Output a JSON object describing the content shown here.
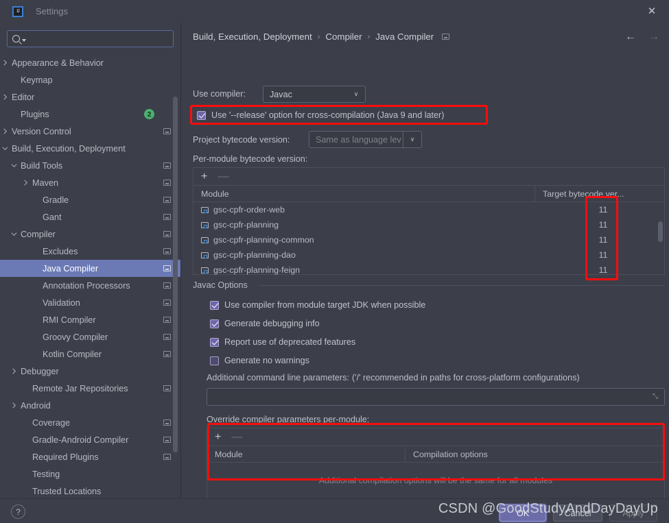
{
  "window": {
    "title": "Settings",
    "logo_text": "IJ",
    "close_label": "✕"
  },
  "search": {
    "value": "",
    "placeholder": ""
  },
  "sidebar": {
    "items": [
      {
        "label": "Appearance & Behavior",
        "indent": 0,
        "chevron": "right",
        "restore": false,
        "badge": null,
        "selected": false
      },
      {
        "label": "Keymap",
        "indent": 1,
        "chevron": "none",
        "restore": false,
        "badge": null,
        "selected": false
      },
      {
        "label": "Editor",
        "indent": 0,
        "chevron": "right",
        "restore": false,
        "badge": null,
        "selected": false
      },
      {
        "label": "Plugins",
        "indent": 1,
        "chevron": "none",
        "restore": false,
        "badge": "2",
        "selected": false
      },
      {
        "label": "Version Control",
        "indent": 0,
        "chevron": "right",
        "restore": true,
        "badge": null,
        "selected": false
      },
      {
        "label": "Build, Execution, Deployment",
        "indent": 0,
        "chevron": "down",
        "restore": false,
        "badge": null,
        "selected": false
      },
      {
        "label": "Build Tools",
        "indent": 1,
        "chevron": "down",
        "restore": true,
        "badge": null,
        "selected": false
      },
      {
        "label": "Maven",
        "indent": 2,
        "chevron": "right",
        "restore": true,
        "badge": null,
        "selected": false
      },
      {
        "label": "Gradle",
        "indent": 3,
        "chevron": "none",
        "restore": true,
        "badge": null,
        "selected": false
      },
      {
        "label": "Gant",
        "indent": 3,
        "chevron": "none",
        "restore": true,
        "badge": null,
        "selected": false
      },
      {
        "label": "Compiler",
        "indent": 1,
        "chevron": "down",
        "restore": true,
        "badge": null,
        "selected": false
      },
      {
        "label": "Excludes",
        "indent": 3,
        "chevron": "none",
        "restore": true,
        "badge": null,
        "selected": false
      },
      {
        "label": "Java Compiler",
        "indent": 3,
        "chevron": "none",
        "restore": true,
        "badge": null,
        "selected": true
      },
      {
        "label": "Annotation Processors",
        "indent": 3,
        "chevron": "none",
        "restore": true,
        "badge": null,
        "selected": false
      },
      {
        "label": "Validation",
        "indent": 3,
        "chevron": "none",
        "restore": true,
        "badge": null,
        "selected": false
      },
      {
        "label": "RMI Compiler",
        "indent": 3,
        "chevron": "none",
        "restore": true,
        "badge": null,
        "selected": false
      },
      {
        "label": "Groovy Compiler",
        "indent": 3,
        "chevron": "none",
        "restore": true,
        "badge": null,
        "selected": false
      },
      {
        "label": "Kotlin Compiler",
        "indent": 3,
        "chevron": "none",
        "restore": true,
        "badge": null,
        "selected": false
      },
      {
        "label": "Debugger",
        "indent": 1,
        "chevron": "right",
        "restore": false,
        "badge": null,
        "selected": false
      },
      {
        "label": "Remote Jar Repositories",
        "indent": 2,
        "chevron": "none",
        "restore": true,
        "badge": null,
        "selected": false
      },
      {
        "label": "Android",
        "indent": 1,
        "chevron": "right",
        "restore": false,
        "badge": null,
        "selected": false
      },
      {
        "label": "Coverage",
        "indent": 2,
        "chevron": "none",
        "restore": true,
        "badge": null,
        "selected": false
      },
      {
        "label": "Gradle-Android Compiler",
        "indent": 2,
        "chevron": "none",
        "restore": true,
        "badge": null,
        "selected": false
      },
      {
        "label": "Required Plugins",
        "indent": 2,
        "chevron": "none",
        "restore": true,
        "badge": null,
        "selected": false
      },
      {
        "label": "Testing",
        "indent": 2,
        "chevron": "none",
        "restore": false,
        "badge": null,
        "selected": false
      },
      {
        "label": "Trusted Locations",
        "indent": 2,
        "chevron": "none",
        "restore": false,
        "badge": null,
        "selected": false
      }
    ]
  },
  "main": {
    "breadcrumb": {
      "part1": "Build, Execution, Deployment",
      "part2": "Compiler",
      "part3": "Java Compiler",
      "separator": "›"
    },
    "nav": {
      "back": "←",
      "forward": "→"
    },
    "use_compiler": {
      "label": "Use compiler:",
      "value": "Javac",
      "arrow": "∨"
    },
    "release_option": {
      "label": "Use '--release' option for cross-compilation (Java 9 and later)",
      "checked": true
    },
    "project_bytecode": {
      "label": "Project bytecode version:",
      "value": "Same as language lev",
      "arrow": "∨",
      "disabled": true
    },
    "per_module": {
      "label": "Per-module bytecode version:",
      "toolbar": {
        "add": "+",
        "remove": "—"
      },
      "columns": [
        "Module",
        "Target bytecode ver..."
      ],
      "rows": [
        {
          "module": "gsc-cpfr-order-web",
          "version": "11"
        },
        {
          "module": "gsc-cpfr-planning",
          "version": "11"
        },
        {
          "module": "gsc-cpfr-planning-common",
          "version": "11"
        },
        {
          "module": "gsc-cpfr-planning-dao",
          "version": "11"
        },
        {
          "module": "gsc-cpfr-planning-feign",
          "version": "11"
        }
      ]
    },
    "javac_options": {
      "title": "Javac Options",
      "checkboxes": [
        {
          "label": "Use compiler from module target JDK when possible",
          "checked": true
        },
        {
          "label": "Generate debugging info",
          "checked": true
        },
        {
          "label": "Report use of deprecated features",
          "checked": true
        },
        {
          "label": "Generate no warnings",
          "checked": false
        }
      ],
      "additional_params": {
        "label": "Additional command line parameters:",
        "hint": "('/' recommended in paths for cross-platform configurations)",
        "value": "",
        "expand_icon": "⤡"
      },
      "override": {
        "label": "Override compiler parameters per-module:",
        "toolbar": {
          "add": "+",
          "remove": "—"
        },
        "columns": [
          "Module",
          "Compilation options"
        ],
        "empty_text": "Additional compilation options will be the same for all modules"
      }
    }
  },
  "footer": {
    "help": "?",
    "ok": "OK",
    "cancel": "Cancel",
    "apply": "Apply"
  },
  "watermark": {
    "text": "CSDN @GoodStudyAndDayDayUp"
  },
  "colors": {
    "annotation_red": "#fb0d0d",
    "selection_blue": "#6b7ab5",
    "badge_green": "#4caf70",
    "background": "#3c3f49"
  }
}
